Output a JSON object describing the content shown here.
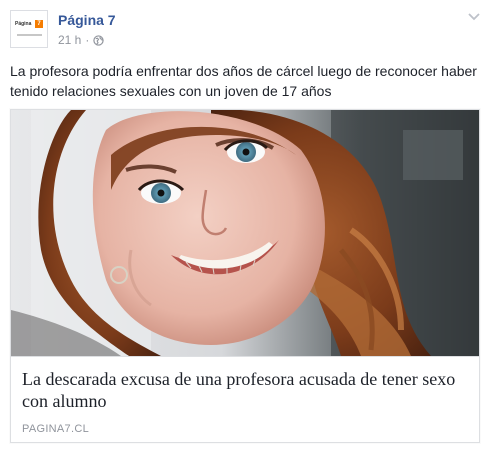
{
  "header": {
    "page_name": "Página 7",
    "time": "21 h",
    "separator": "·",
    "avatar_logo_word": "Página",
    "avatar_logo_number": "7"
  },
  "post": {
    "text": "La profesora podría enfrentar dos años de cárcel luego de reconocer haber tenido relaciones sexuales con un joven de 17 años"
  },
  "link": {
    "title": "La descarada excusa de una profesora acusada de tener sexo con alumno",
    "domain": "PAGINA7.CL"
  },
  "icons": {
    "audience": "globe-icon",
    "options": "chevron-down-icon"
  },
  "colors": {
    "link_blue": "#365899",
    "meta_gray": "#90949c",
    "text": "#1d2129",
    "border": "#dddfe2",
    "logo_orange": "#f57c00"
  }
}
